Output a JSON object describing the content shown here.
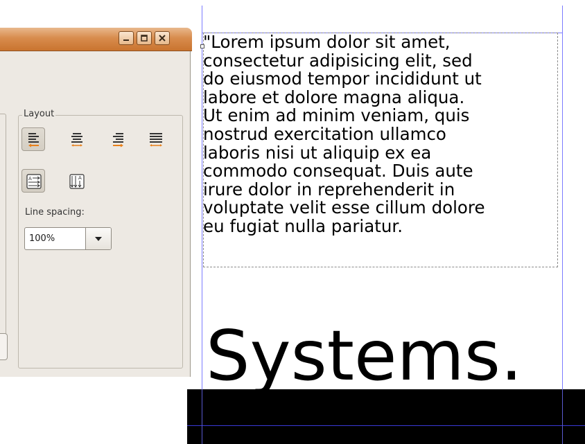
{
  "dialog": {
    "window_buttons": {
      "minimize_icon": "minimize-icon",
      "maximize_icon": "maximize-icon",
      "close_icon": "close-icon"
    },
    "layout": {
      "legend": "Layout",
      "alignment_buttons": [
        {
          "name": "align-left",
          "active": true
        },
        {
          "name": "align-center",
          "active": false
        },
        {
          "name": "align-right",
          "active": false
        },
        {
          "name": "align-justify",
          "active": false
        }
      ],
      "flow_buttons": [
        {
          "name": "horizontal-text",
          "active": true
        },
        {
          "name": "vertical-text",
          "active": false
        }
      ],
      "line_spacing_label": "Line spacing:",
      "line_spacing_value": "100%"
    }
  },
  "canvas": {
    "text_lines": [
      "\"Lorem ipsum dolor sit amet,",
      "consectetur adipisicing elit, sed",
      "do eiusmod tempor incididunt ut",
      "labore et dolore magna aliqua.",
      "Ut enim ad minim veniam, quis",
      "nostrud exercitation ullamco",
      "laboris nisi ut aliquip ex ea",
      "commodo consequat. Duis aute",
      "irure dolor in reprehenderit in",
      "voluptate velit esse cillum dolore",
      "eu fugiat nulla pariatur."
    ],
    "big_text": "Systems."
  },
  "colors": {
    "titlebar": "#d88c4d",
    "dialog_bg": "#ede9e3",
    "guide": "#7b7bff",
    "arrow_accent": "#e8801a"
  }
}
